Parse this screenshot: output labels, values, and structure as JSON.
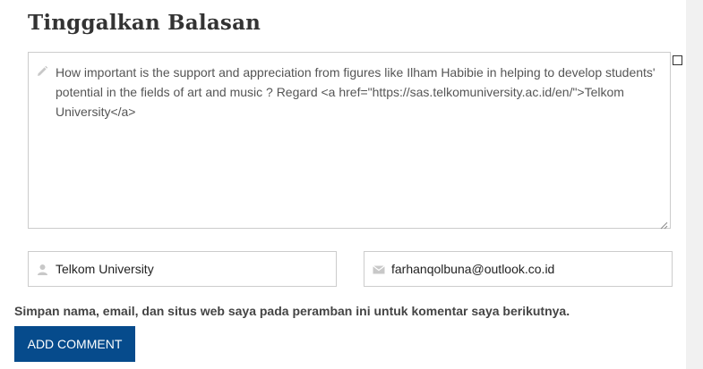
{
  "reply": {
    "title": "Tinggalkan Balasan",
    "comment_value": "How important is the support and appreciation from figures like Ilham Habibie in helping to develop students' potential in the fields of art and music ? Regard <a href=\"https://sas.telkomuniversity.ac.id/en/\">Telkom University</a>",
    "name_value": "Telkom University",
    "email_value": "farhanqolbuna@outlook.co.id",
    "cookie_consent_label": "Simpan nama, email, dan situs web saya pada peramban ini untuk komentar saya berikutnya.",
    "submit_label": "ADD COMMENT"
  },
  "icons": {
    "comment": "pencil-icon",
    "name": "user-icon",
    "email": "envelope-icon"
  },
  "colors": {
    "button_bg": "#064b8c",
    "button_text": "#ffffff",
    "border": "#cccccc",
    "icon": "#c8c8c8"
  }
}
